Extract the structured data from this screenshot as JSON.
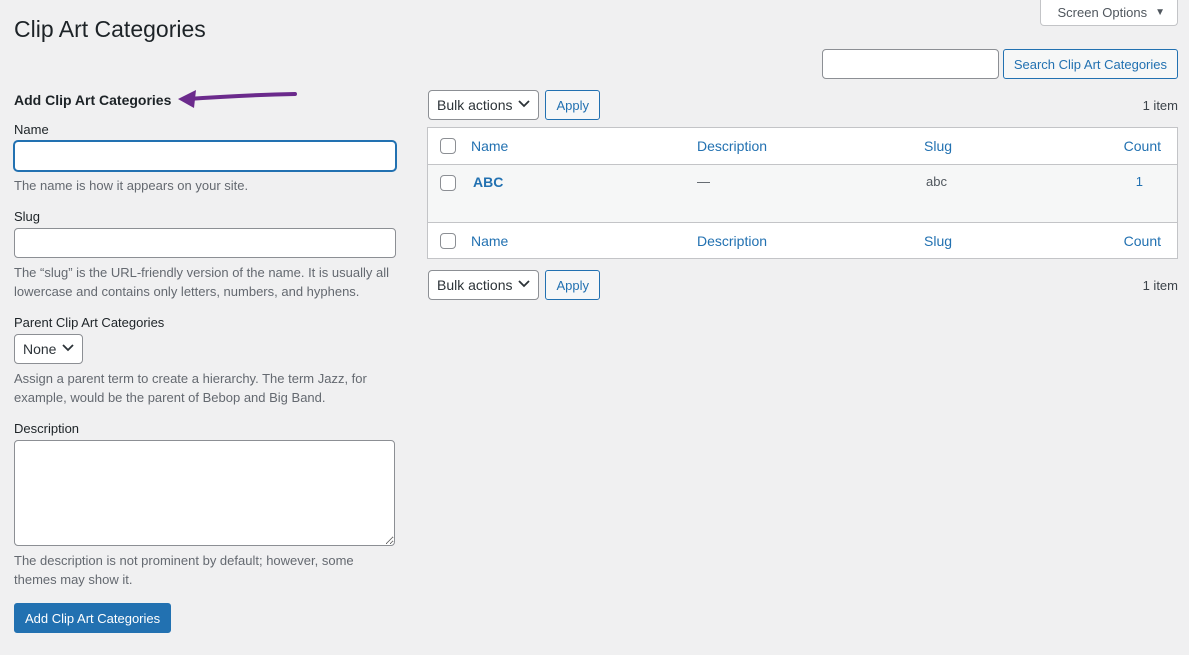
{
  "page": {
    "title": "Clip Art Categories"
  },
  "screen_options": {
    "label": "Screen Options",
    "caret": "▼"
  },
  "search": {
    "value": "",
    "button_label": "Search Clip Art Categories"
  },
  "form": {
    "heading": "Add Clip Art Categories",
    "name": {
      "label": "Name",
      "value": "",
      "help": "The name is how it appears on your site."
    },
    "slug": {
      "label": "Slug",
      "value": "",
      "help": "The “slug” is the URL-friendly version of the name. It is usually all lowercase and contains only letters, numbers, and hyphens."
    },
    "parent": {
      "label": "Parent Clip Art Categories",
      "selected": "None",
      "help": "Assign a parent term to create a hierarchy. The term Jazz, for example, would be the parent of Bebop and Big Band."
    },
    "description": {
      "label": "Description",
      "value": "",
      "help": "The description is not prominent by default; however, some themes may show it."
    },
    "submit_label": "Add Clip Art Categories"
  },
  "annotation": {
    "arrow_color": "#6b2a8c"
  },
  "table_nav_top": {
    "bulk_label": "Bulk actions",
    "apply_label": "Apply",
    "count": "1 item"
  },
  "table_nav_bottom": {
    "bulk_label": "Bulk actions",
    "apply_label": "Apply",
    "count": "1 item"
  },
  "table": {
    "columns": {
      "name": "Name",
      "description": "Description",
      "slug": "Slug",
      "count": "Count"
    },
    "rows": [
      {
        "name": "ABC",
        "description": "—",
        "slug": "abc",
        "count": "1"
      }
    ]
  },
  "colors": {
    "accent": "#2271b1",
    "background": "#f0f0f1"
  }
}
